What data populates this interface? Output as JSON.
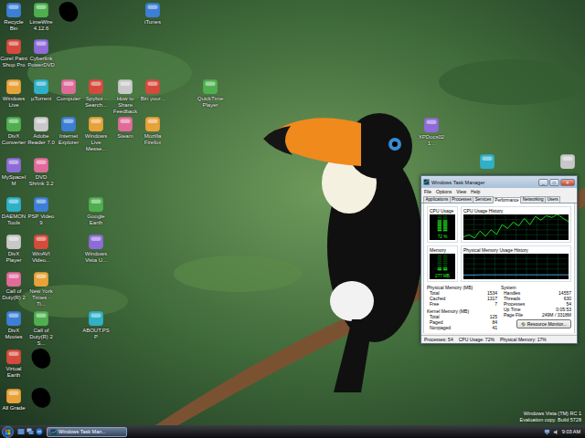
{
  "desktop_icons": [
    {
      "label": "Recycle Bin",
      "kind": "app"
    },
    {
      "label": "Corel Paint Shop Pro",
      "kind": "app"
    },
    {
      "label": "Windows Live",
      "kind": "app"
    },
    {
      "label": "DivX Converter",
      "kind": "app"
    },
    {
      "label": "MySpaceIM",
      "kind": "app"
    },
    {
      "label": "DAEMON Tools",
      "kind": "app"
    },
    {
      "label": "DivX Player",
      "kind": "app"
    },
    {
      "label": "Call of Duty(R) 2",
      "kind": "app"
    },
    {
      "label": "DivX Movies",
      "kind": "app"
    },
    {
      "label": "Virtual Earth",
      "kind": "app"
    },
    {
      "label": "All Grade",
      "kind": "app"
    },
    {
      "label": "LimeWire 4.12.6",
      "kind": "app"
    },
    {
      "label": "Cyberlink PowerDVD",
      "kind": "app"
    },
    {
      "label": "µTorrent",
      "kind": "app"
    },
    {
      "label": "Adobe Reader 7.0",
      "kind": "app"
    },
    {
      "label": "DVD Shrink 3.2",
      "kind": "app"
    },
    {
      "label": "PSP Video 9",
      "kind": "app"
    },
    {
      "label": "WinAVI Video...",
      "kind": "app"
    },
    {
      "label": "New York Times - Ti...",
      "kind": "app"
    },
    {
      "label": "Call of Duty(R) 2 S...",
      "kind": "app"
    },
    {
      "kind": "redacted"
    },
    {
      "kind": "redacted"
    },
    {
      "kind": "redacted"
    },
    {
      "label": "Computer",
      "kind": "app"
    },
    {
      "label": "Internet Explorer",
      "kind": "app"
    },
    {
      "label": "Spybot - Search...",
      "kind": "app"
    },
    {
      "label": "Windows Live Messe...",
      "kind": "app"
    },
    {
      "label": "Google Earth",
      "kind": "app"
    },
    {
      "label": "Windows Vista U...",
      "kind": "app"
    },
    {
      "label": "ABOUT.PSP",
      "kind": "app"
    },
    {
      "label": "How to Share Feedback",
      "kind": "app"
    },
    {
      "label": "Steam",
      "kind": "app"
    },
    {
      "label": "iTunes",
      "kind": "app"
    },
    {
      "label": "Bin your...",
      "kind": "app"
    },
    {
      "label": "Mozilla Firefox",
      "kind": "app"
    },
    {
      "label": "QuickTime Player",
      "kind": "app"
    },
    {
      "label": "XPDocs021...",
      "kind": "app"
    },
    {
      "kind": "unlabeled"
    },
    {
      "kind": "unlabeled"
    }
  ],
  "task_manager": {
    "title": "Windows Task Manager",
    "controls": [
      "_",
      "□",
      "✕"
    ],
    "menu": [
      "File",
      "Options",
      "View",
      "Help"
    ],
    "tabs": [
      {
        "label": "Applications",
        "selected": false
      },
      {
        "label": "Processes",
        "selected": false
      },
      {
        "label": "Services",
        "selected": false
      },
      {
        "label": "Performance",
        "selected": true
      },
      {
        "label": "Networking",
        "selected": false
      },
      {
        "label": "Users",
        "selected": false
      }
    ],
    "cpu": {
      "title": "CPU Usage",
      "reading": "72 %",
      "level": 0.72
    },
    "cpu_history": {
      "title": "CPU Usage History",
      "values": [
        12,
        20,
        8,
        35,
        15,
        40,
        22,
        60,
        45,
        70,
        55,
        85,
        60,
        92,
        78,
        95,
        88,
        100,
        85,
        72
      ]
    },
    "memory": {
      "title": "Memory",
      "reading": "277 MB",
      "level": 0.17
    },
    "memory_history": {
      "title": "Physical Memory Usage History",
      "values": [
        16,
        16,
        16,
        17,
        17,
        17,
        17,
        17,
        17,
        17,
        17,
        17,
        17,
        17,
        17,
        17,
        17,
        17,
        17,
        17
      ]
    },
    "physical_memory": {
      "title": "Physical Memory (MB)",
      "rows": [
        {
          "label": "Total",
          "value": "1534"
        },
        {
          "label": "Cached",
          "value": "1317"
        },
        {
          "label": "Free",
          "value": "7"
        }
      ]
    },
    "kernel_memory": {
      "title": "Kernel Memory (MB)",
      "rows": [
        {
          "label": "Total",
          "value": "125"
        },
        {
          "label": "Paged",
          "value": "84"
        },
        {
          "label": "Nonpaged",
          "value": "41"
        }
      ]
    },
    "system": {
      "title": "System",
      "rows": [
        {
          "label": "Handles",
          "value": "14557"
        },
        {
          "label": "Threads",
          "value": "630"
        },
        {
          "label": "Processes",
          "value": "54"
        },
        {
          "label": "Up Time",
          "value": "0:05:53"
        },
        {
          "label": "Page File",
          "value": "249M / 3318M"
        }
      ]
    },
    "resource_button": "Resource Monitor...",
    "status": [
      "Processes: 54",
      "CPU Usage: 72%",
      "Physical Memory: 17%"
    ]
  },
  "watermark": [
    "Windows Vista (TM) RC 1",
    "Evaluation copy. Build 5728"
  ],
  "taskbar": {
    "task_buttons": [
      {
        "label": "Windows Task Man...",
        "selected": true
      }
    ],
    "clock": "9:03 AM"
  }
}
